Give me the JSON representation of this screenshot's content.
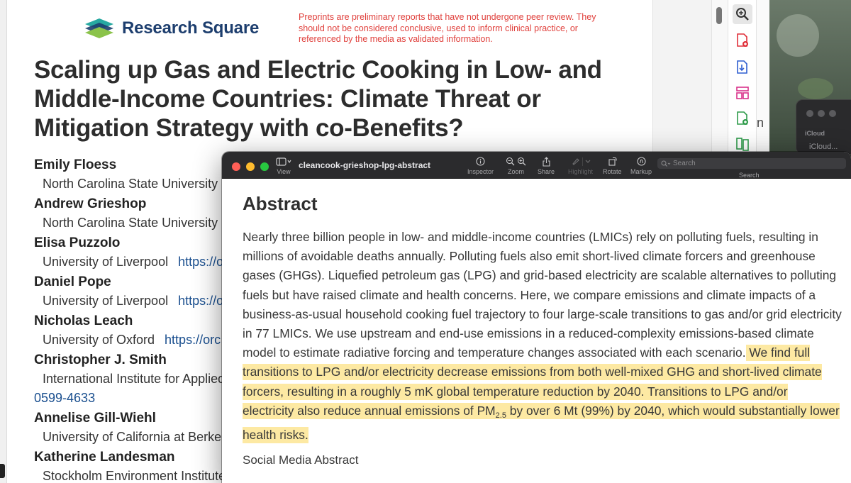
{
  "background_pdf": {
    "logo_text": "Research Square",
    "preprint_notice": "Preprints are preliminary reports that have not undergone peer review. They should not be considered conclusive, used to inform clinical practice, or referenced by the media as validated information.",
    "paper_title": "Scaling up Gas and Electric Cooking in Low- and Middle-Income Countries: Climate Threat or Mitigation Strategy with co-Benefits?",
    "authors": [
      {
        "name": "Emily Floess",
        "affiliation": "North Carolina State University",
        "orcid": ""
      },
      {
        "name": "Andrew Grieshop",
        "affiliation": "North Carolina State University",
        "orcid": ""
      },
      {
        "name": "Elisa Puzzolo",
        "affiliation": "University of Liverpool",
        "orcid": "https://o"
      },
      {
        "name": "Daniel Pope",
        "affiliation": "University of Liverpool",
        "orcid": "https://o"
      },
      {
        "name": "Nicholas Leach",
        "affiliation": "University of Oxford",
        "orcid": "https://orc"
      },
      {
        "name": "Christopher J. Smith",
        "affiliation": "International Institute for Applied",
        "orcid": "",
        "orcid_tail": "0599-4633"
      },
      {
        "name": "Annelise Gill-Wiehl",
        "affiliation": "University of California at Berkel",
        "orcid": ""
      },
      {
        "name": "Katherine Landesman",
        "affiliation": "Stockholm Environment Institute",
        "orcid": ""
      }
    ],
    "right_strip_char": "n"
  },
  "icloud_window": {
    "heading": "iCloud",
    "item": "iCloud..."
  },
  "preview_window": {
    "title": "cleancook-grieshop-lpg-abstract",
    "toolbar": {
      "view": "View",
      "inspector": "Inspector",
      "zoom": "Zoom",
      "share": "Share",
      "highlight": "Highlight",
      "rotate": "Rotate",
      "markup": "Markup",
      "search_label": "Search",
      "search_placeholder": "Search"
    },
    "content": {
      "heading": "Abstract",
      "plain_text": "Nearly three billion people in low- and middle-income countries (LMICs) rely on polluting fuels, resulting in millions of avoidable deaths annually. Polluting fuels also emit short-lived climate forcers and greenhouse gases (GHGs). Liquefied petroleum gas (LPG) and grid-based electricity are scalable alternatives to polluting fuels but have raised climate and health concerns. Here, we compare emissions and climate impacts of a business-as-usual household cooking fuel trajectory to four large-scale transitions to gas and/or grid electricity in 77 LMICs. We use upstream and end-use emissions in a reduced-complexity emissions-based climate model to estimate radiative forcing and temperature changes associated with each scenario.",
      "highlighted_text_a": " We find full transitions to LPG and/or electricity decrease emissions from both well-mixed GHG and short-lived climate forcers, resulting in a roughly 5 mK global temperature reduction by 2040. Transitions to LPG and/or electricity also reduce annual emissions of PM",
      "highlight_subscript": "2.5",
      "highlighted_text_b": " by over 6 Mt (99%) by 2040, which would substantially lower health risks.",
      "highlight_color": "#fde9a3",
      "next_section": "Social Media Abstract"
    }
  },
  "colors": {
    "preprint_notice": "#e0403c",
    "logo_navy": "#1d3e6e",
    "orcid_link": "#1a4f8f",
    "toolbar_bg": "#2b2b2d"
  }
}
